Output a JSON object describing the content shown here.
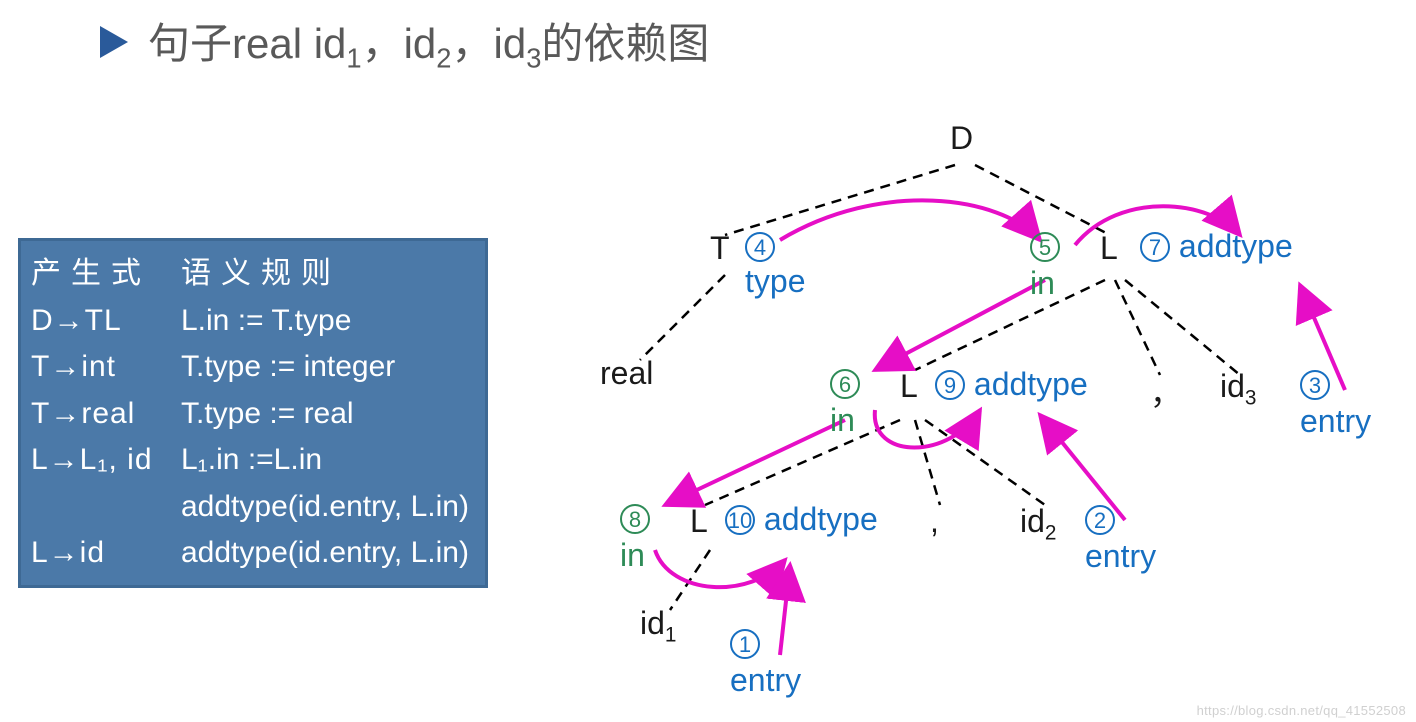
{
  "title": {
    "prefix": "句子real  id",
    "sub1": "1",
    "mid1": "，id",
    "sub2": "2",
    "mid2": "，id",
    "sub3": "3",
    "suffix": "的依赖图"
  },
  "rules": {
    "header_col1": "产生式",
    "header_col2": "语义规则",
    "rows": [
      {
        "p": "D→TL",
        "s": "L.in := T.type"
      },
      {
        "p": "T→int",
        "s": "T.type := integer"
      },
      {
        "p": "T→real",
        "s": "T.type := real"
      },
      {
        "p": "L→L₁, id",
        "s": "L₁.in :=L.in"
      },
      {
        "p": "",
        "s": "addtype(id.entry, L.in)"
      },
      {
        "p": "L→id",
        "s": "addtype(id.entry, L.in)"
      }
    ]
  },
  "diagram": {
    "D": "D",
    "T": "T",
    "L": "L",
    "real": "real",
    "id1_base": "id",
    "id1_sub": "1",
    "id2_base": "id",
    "id2_sub": "2",
    "id3_base": "id",
    "id3_sub": "3",
    "comma": "，",
    "comma_ascii": ",",
    "type": "type",
    "in": "in",
    "addtype": "addtype",
    "entry": "entry",
    "n1": "1",
    "n2": "2",
    "n3": "3",
    "n4": "4",
    "n5": "5",
    "n6": "6",
    "n7": "7",
    "n8": "8",
    "n9": "9",
    "n10": "10"
  },
  "watermark": "https://blog.csdn.net/qq_41552508"
}
